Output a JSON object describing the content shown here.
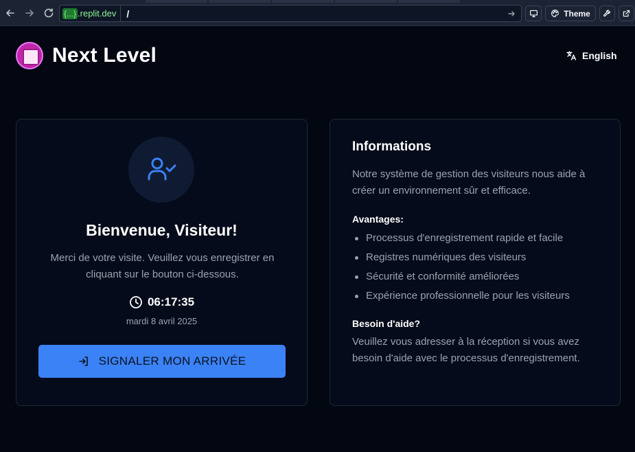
{
  "browser": {
    "url_badge": "{...}",
    "url_domain": ".replit.dev",
    "url_path": "/",
    "theme_label": "Theme"
  },
  "header": {
    "brand": "Next Level",
    "language_label": "English"
  },
  "welcome_card": {
    "title": "Bienvenue, Visiteur!",
    "text": "Merci de votre visite. Veuillez vous enregistrer en cliquant sur le bouton ci-dessous.",
    "time": "06:17:35",
    "date": "mardi 8 avril 2025",
    "checkin_label": "SIGNALER MON ARRIVÉE"
  },
  "info_card": {
    "title": "Informations",
    "description": "Notre système de gestion des visiteurs nous aide à créer un environnement sûr et efficace.",
    "benefits_title": "Avantages:",
    "benefits": [
      "Processus d'enregistrement rapide et facile",
      "Registres numériques des visiteurs",
      "Sécurité et conformité améliorées",
      "Expérience professionnelle pour les visiteurs"
    ],
    "help_title": "Besoin d'aide?",
    "help_text": "Veuillez vous adresser à la réception si vous avez besoin d'aide avec le processus d'enregistrement."
  },
  "colors": {
    "page_bg": "#030712",
    "card_bg": "#050b1a",
    "accent": "#3b82f6",
    "muted_text": "#9ca3af"
  },
  "icons": {
    "back": "arrow-left-icon",
    "forward": "arrow-right-icon",
    "reload": "reload-icon",
    "go": "arrow-right-icon",
    "device": "monitor-icon",
    "theme": "palette-icon",
    "devtools": "wrench-icon",
    "open": "external-link-icon",
    "language": "translate-icon",
    "avatar": "user-check-icon",
    "clock": "clock-icon",
    "checkin": "log-in-icon"
  }
}
